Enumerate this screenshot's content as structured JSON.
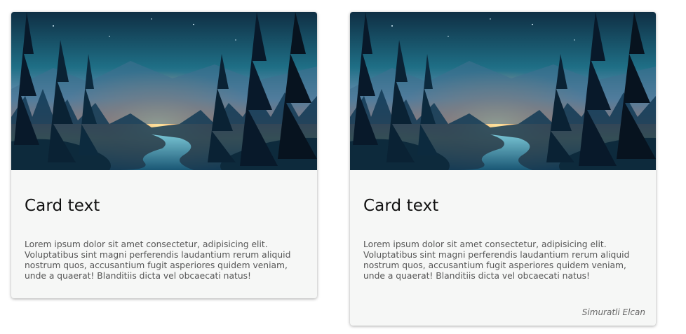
{
  "cards": [
    {
      "title": "Card text",
      "description": "Lorem ipsum dolor sit amet consectetur, adipisicing elit. Voluptatibus sint magni perferendis laudantium rerum aliquid nostrum quos, accusantium fugit asperiores quidem veniam, unde a quaerat! Blanditiis dicta vel obcaecati natus!",
      "image": "forest-sunset-illustration"
    },
    {
      "title": "Card text",
      "description": "Lorem ipsum dolor sit amet consectetur, adipisicing elit. Voluptatibus sint magni perferendis laudantium rerum aliquid nostrum quos, accusantium fugit asperiores quidem veniam, unde a quaerat! Blanditiis dicta vel obcaecati natus!",
      "image": "forest-sunset-illustration",
      "author": "Simuratli Elcan"
    }
  ],
  "colors": {
    "card_bg": "#f6f7f6",
    "title": "#111111",
    "text": "#555555",
    "author": "#666666",
    "sky_top": "#0c2a3e",
    "sky_glow": "#f2b15c",
    "tree_dark": "#0a1c2b"
  }
}
